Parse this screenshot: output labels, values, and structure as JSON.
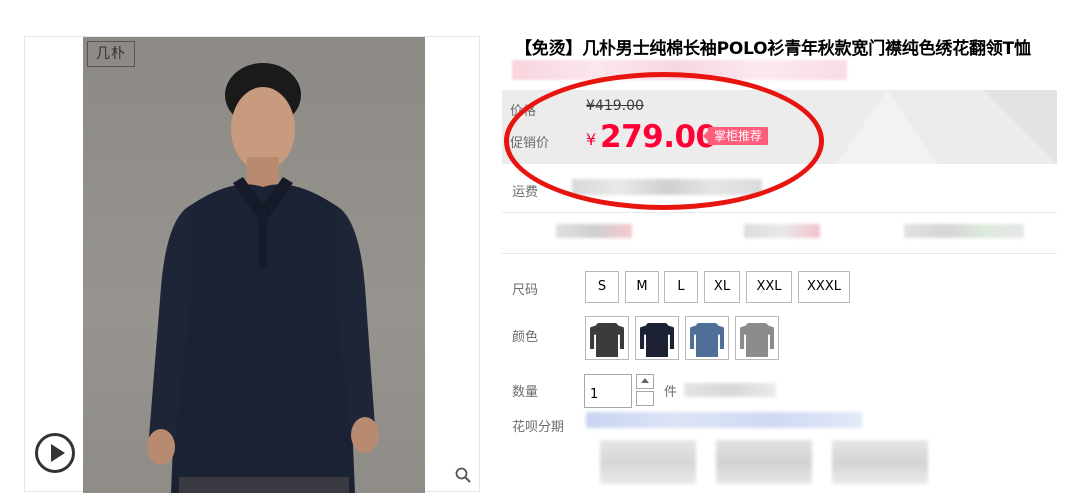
{
  "product": {
    "title": "【免烫】几朴男士纯棉长袖POLO衫青年秋款宽门襟纯色绣花翻领T恤",
    "brand_logo_text": "几朴"
  },
  "price": {
    "original_label": "价格",
    "original_value": "¥419.00",
    "promo_label": "促销价",
    "currency": "¥",
    "promo_value": "279.00",
    "badge": "掌柜推荐",
    "accent_color": "#ff0036"
  },
  "shipping": {
    "label": "运费"
  },
  "size": {
    "label": "尺码",
    "options": [
      "S",
      "M",
      "L",
      "XL",
      "XXL",
      "XXXL"
    ]
  },
  "color": {
    "label": "颜色",
    "swatches": [
      {
        "name": "dark-gray",
        "color": "#3b3b3d"
      },
      {
        "name": "navy",
        "color": "#1c2233"
      },
      {
        "name": "blue",
        "color": "#4f6f99"
      },
      {
        "name": "gray",
        "color": "#8c8c8c"
      }
    ]
  },
  "quantity": {
    "label": "数量",
    "value": "1",
    "unit": "件"
  },
  "installment": {
    "label": "花呗分期"
  },
  "icons": {
    "play": "play-circle-icon",
    "zoom": "magnifier-icon",
    "qty_up": "chevron-up-icon",
    "qty_down": "chevron-down-icon"
  }
}
